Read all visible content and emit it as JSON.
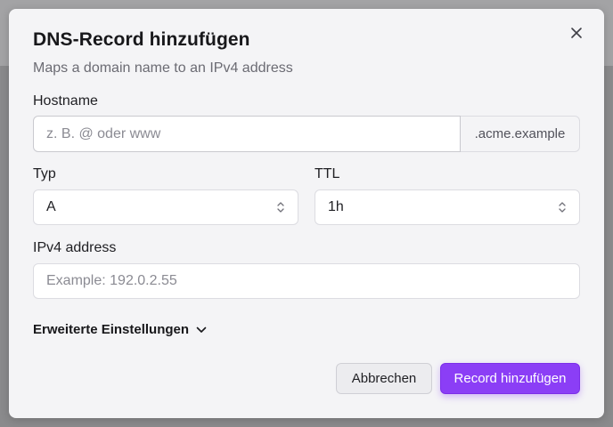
{
  "dialog": {
    "title": "DNS-Record hinzufügen",
    "subtitle": "Maps a domain name to an IPv4 address",
    "close_icon": "close-icon"
  },
  "fields": {
    "hostname": {
      "label": "Hostname",
      "placeholder": "z. B. @ oder www",
      "value": "",
      "suffix": ".acme.example"
    },
    "type": {
      "label": "Typ",
      "selected": "A"
    },
    "ttl": {
      "label": "TTL",
      "selected": "1h"
    },
    "ipv4": {
      "label": "IPv4 address",
      "placeholder": "Example: 192.0.2.55",
      "value": ""
    }
  },
  "advanced": {
    "label": "Erweiterte Einstellungen",
    "icon": "chevron-down-icon"
  },
  "actions": {
    "cancel_label": "Abbrechen",
    "submit_label": "Record hinzufügen"
  },
  "colors": {
    "primary": "#8b3ef6",
    "dialog_bg": "#f4f4f6",
    "overlay": "#8a8a8c"
  }
}
